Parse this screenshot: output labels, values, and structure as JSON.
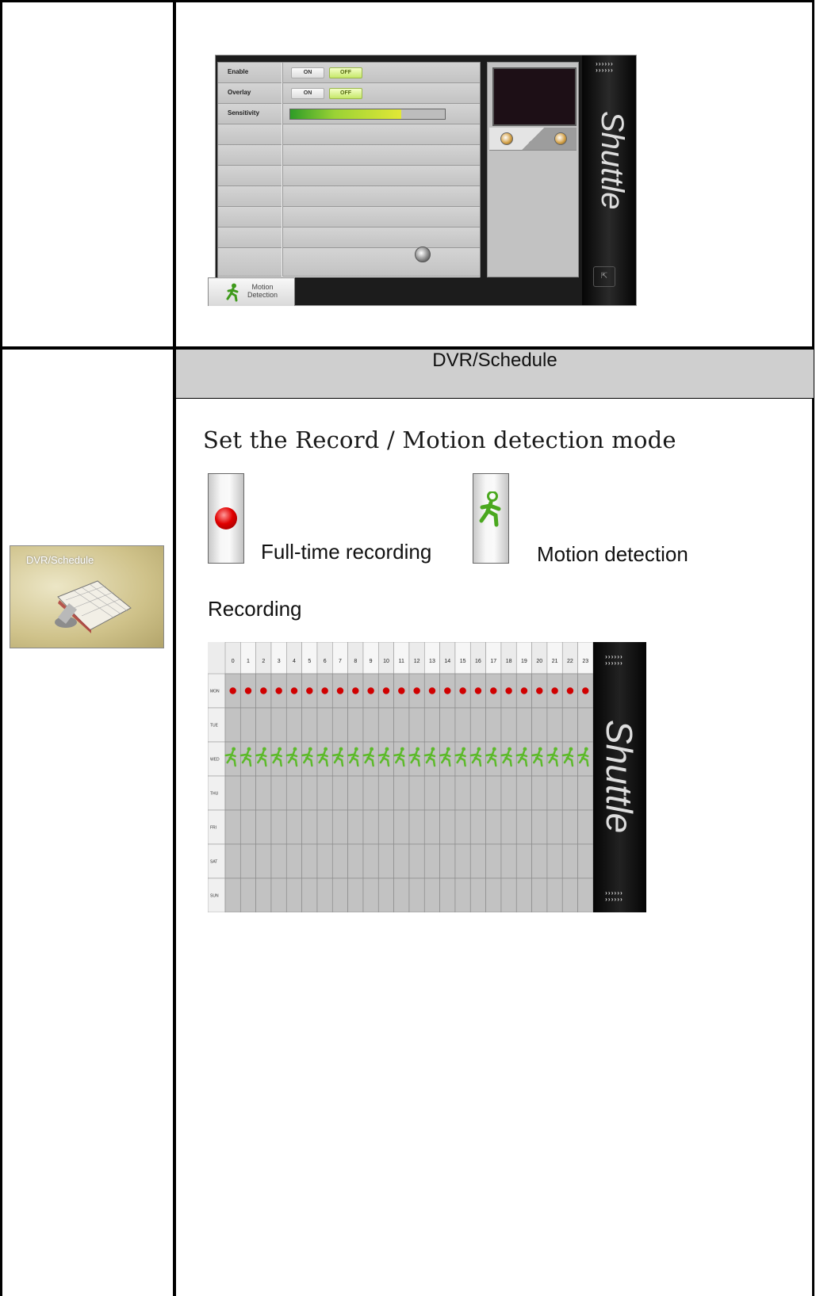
{
  "motion_panel": {
    "rows": [
      {
        "label": "Enable",
        "on": "ON",
        "off": "OFF"
      },
      {
        "label": "Overlay",
        "on": "ON",
        "off": "OFF"
      },
      {
        "label": "Sensitivity"
      }
    ],
    "sensitivity_fraction": 0.72,
    "tab_label": "Motion Detection",
    "brand": "Shuttle"
  },
  "section_title": "DVR/Schedule",
  "intro_text": "Set the Record / Motion detection mode",
  "modes": {
    "full_time": "Full-time recording",
    "motion": "Motion detection"
  },
  "thumbnail_label": "DVR/Schedule",
  "recording_label": "Recording",
  "schedule": {
    "hours": [
      "0",
      "1",
      "2",
      "3",
      "4",
      "5",
      "6",
      "7",
      "8",
      "9",
      "10",
      "11",
      "12",
      "13",
      "14",
      "15",
      "16",
      "17",
      "18",
      "19",
      "20",
      "21",
      "22",
      "23"
    ],
    "days": [
      "MON",
      "TUE",
      "WED",
      "THU",
      "FRI",
      "SAT",
      "SUN"
    ],
    "rows": [
      "RRRRRRRRRRRRRRRRRRRRRRRR",
      "------------------------",
      "MMMMMMMMMMMMMMMMMMMMMMMM",
      "------------------------",
      "------------------------",
      "------------------------",
      "------------------------"
    ],
    "brand": "Shuttle"
  }
}
